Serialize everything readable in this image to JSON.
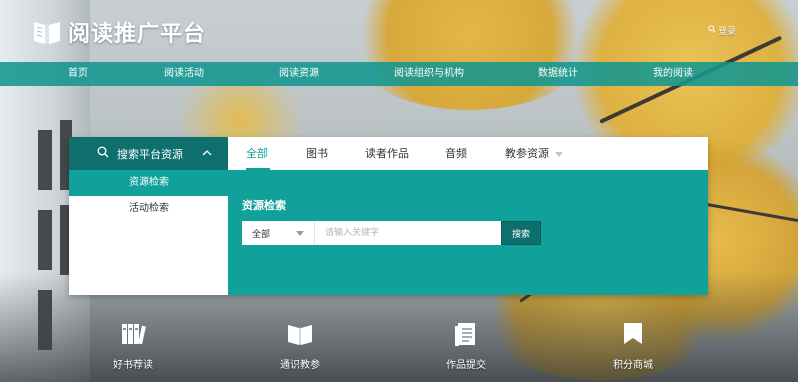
{
  "header": {
    "site_title": "阅读推广平台",
    "login_label": "登录"
  },
  "nav": {
    "items": [
      {
        "label": "首页"
      },
      {
        "label": "阅读活动"
      },
      {
        "label": "阅读资源"
      },
      {
        "label": "阅读组织与机构"
      },
      {
        "label": "数据统计"
      },
      {
        "label": "我的阅读"
      }
    ]
  },
  "search_panel": {
    "side_title": "搜索平台资源",
    "side_items": [
      {
        "label": "资源检索",
        "active": true
      },
      {
        "label": "活动检索",
        "active": false
      }
    ],
    "tabs": [
      {
        "label": "全部",
        "active": true
      },
      {
        "label": "图书"
      },
      {
        "label": "读者作品"
      },
      {
        "label": "音频"
      },
      {
        "label": "教参资源"
      }
    ],
    "section_title": "资源检索",
    "category_select": "全部",
    "keyword_placeholder": "请输入关键字",
    "search_button": "搜索"
  },
  "quick_links": [
    {
      "label": "好书荐读",
      "icon": "books-icon"
    },
    {
      "label": "通识教参",
      "icon": "open-book-icon"
    },
    {
      "label": "作品提交",
      "icon": "document-icon"
    },
    {
      "label": "积分商城",
      "icon": "bookmark-flag-icon"
    }
  ],
  "colors": {
    "accent": "#10a19b",
    "accent_dark": "#0e6f6d",
    "nav_bg": "#129690"
  }
}
